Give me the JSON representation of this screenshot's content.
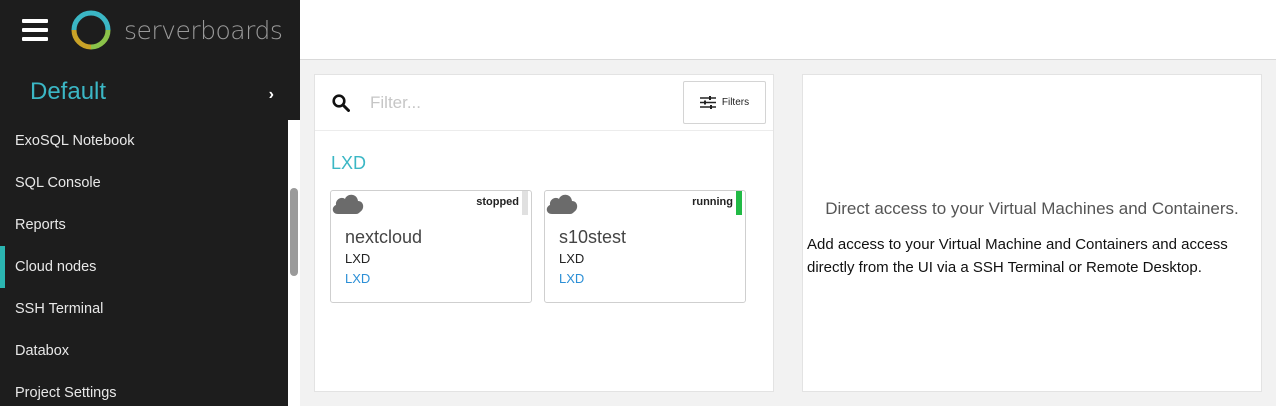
{
  "app": {
    "name": "serverboards",
    "project": "Default"
  },
  "sidebar": {
    "items": [
      {
        "label": "ExoSQL Notebook"
      },
      {
        "label": "SQL Console"
      },
      {
        "label": "Reports"
      },
      {
        "label": "Cloud nodes",
        "active": true
      },
      {
        "label": "SSH Terminal"
      },
      {
        "label": "Databox"
      },
      {
        "label": "Project Settings"
      }
    ]
  },
  "filter": {
    "placeholder": "Filter...",
    "button_label": "Filters"
  },
  "group": {
    "title": "LXD",
    "nodes": [
      {
        "name": "nextcloud",
        "type": "LXD",
        "provider": "LXD",
        "status": "stopped",
        "status_color": "#e0e0e0"
      },
      {
        "name": "s10stest",
        "type": "LXD",
        "provider": "LXD",
        "status": "running",
        "status_color": "#21ba45"
      }
    ]
  },
  "info": {
    "title": "Direct access to your Virtual Machines and Containers.",
    "description": "Add access to your Virtual Machine and Containers and access directly from the UI via a SSH Terminal or Remote Desktop."
  },
  "colors": {
    "accent": "#3bb7c5",
    "active_marker": "#2bb5b1",
    "link": "#2c8fd6",
    "running": "#21ba45"
  }
}
